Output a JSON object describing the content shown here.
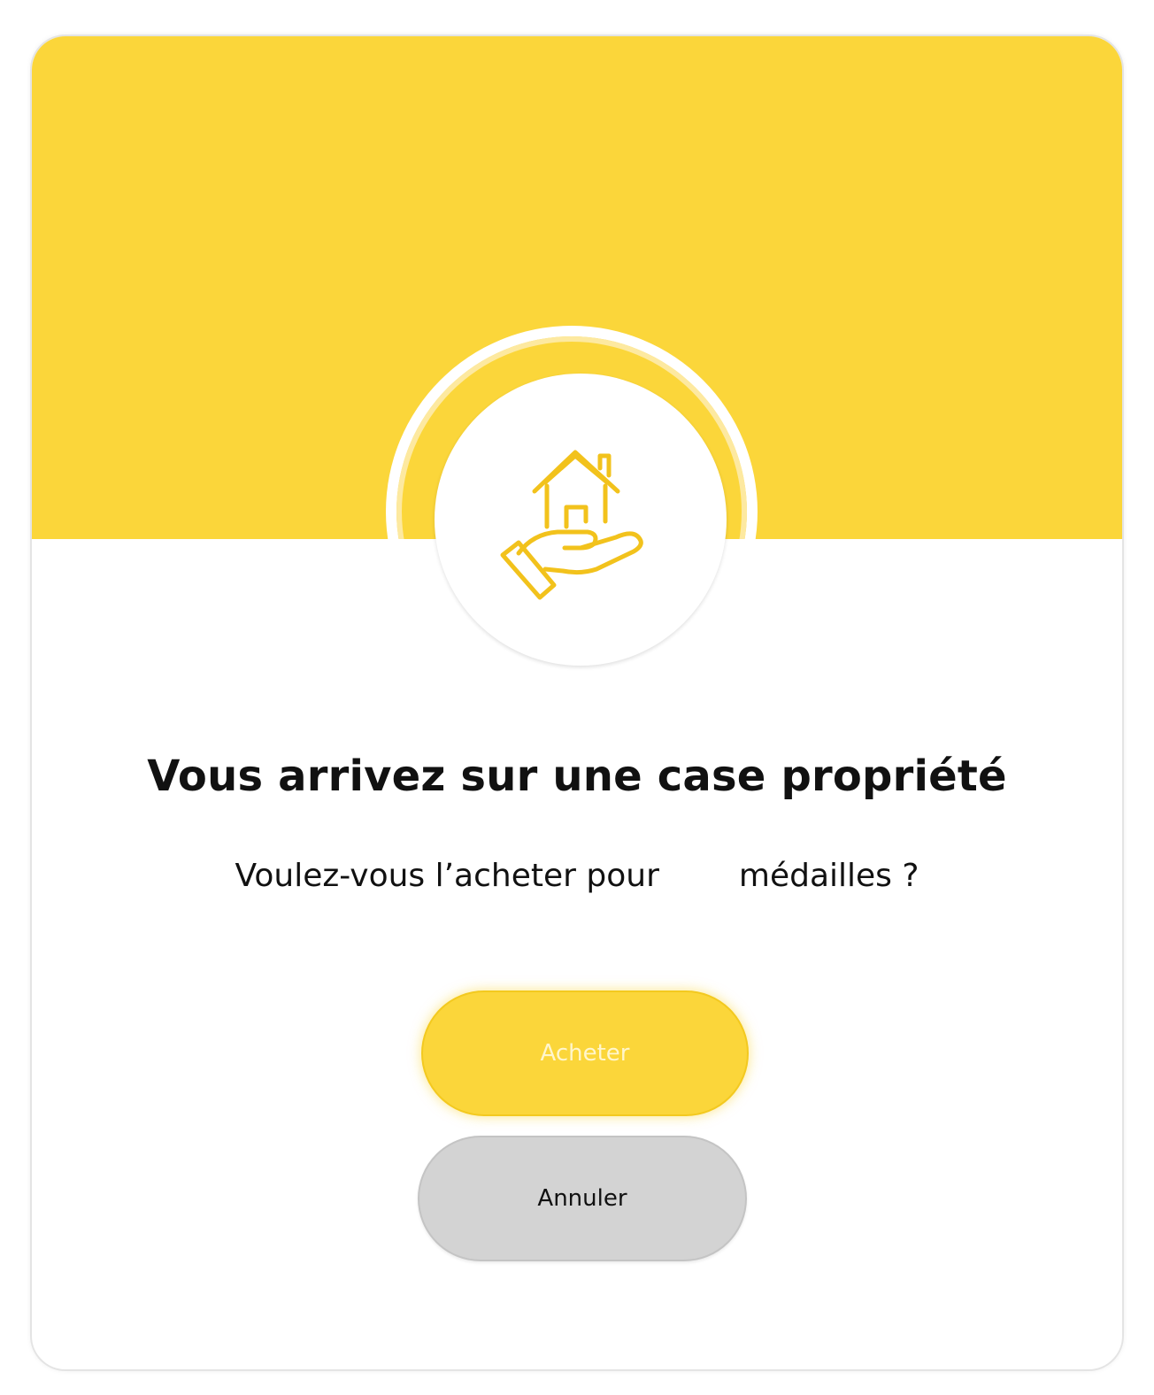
{
  "dialog": {
    "icon": "hand-holding-house-icon",
    "title": "Vous arrivez sur une case propriété",
    "question_prefix": "Voulez-vous l’acheter pour",
    "question_price": "",
    "question_suffix": "médailles ?"
  },
  "actions": {
    "buy_label": "Acheter",
    "cancel_label": "Annuler"
  },
  "colors": {
    "accent": "#fbd63a",
    "cancel": "#d3d3d3",
    "text": "#111111"
  }
}
